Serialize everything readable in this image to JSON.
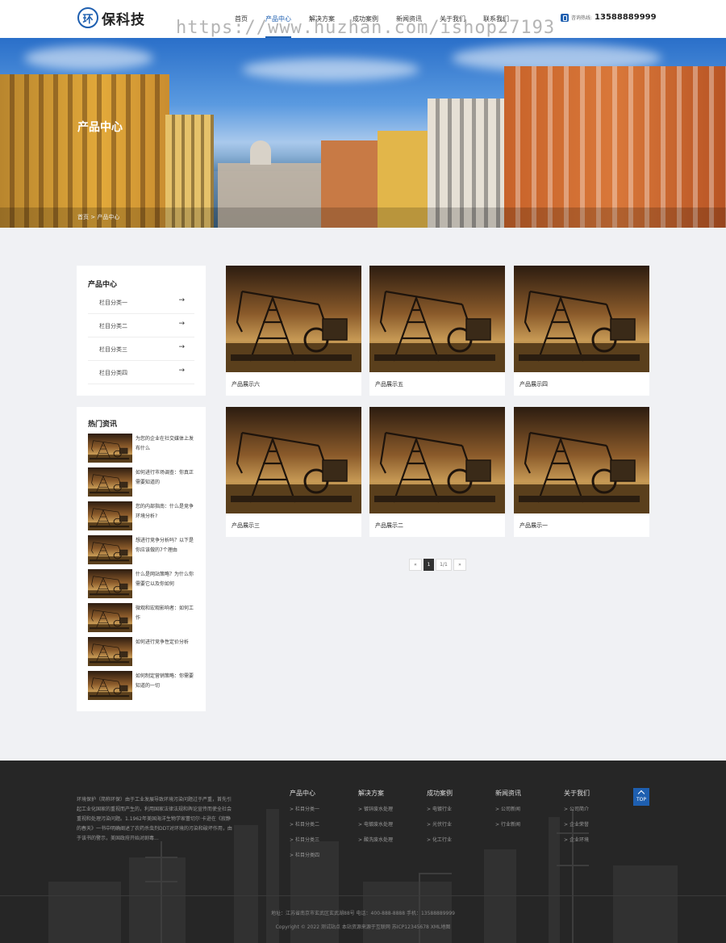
{
  "header": {
    "logo_badge": "环",
    "logo_text": "保科技",
    "nav": [
      "首页",
      "产品中心",
      "解决方案",
      "成功案例",
      "新闻资讯",
      "关于我们",
      "联系我们"
    ],
    "active_nav": "产品中心",
    "hotline_label": "咨询热线:",
    "hotline_number": "13588889999",
    "watermark": "https://www.huzhan.com/ishop27193"
  },
  "banner": {
    "title": "产品中心",
    "breadcrumb": "首页 > 产品中心"
  },
  "sidebar": {
    "categories_title": "产品中心",
    "categories": [
      "栏目分类一",
      "栏目分类二",
      "栏目分类三",
      "栏目分类四"
    ],
    "arrow": "→",
    "news_title": "热门资讯",
    "news": [
      "为您的企业在社交媒体上发布什么",
      "如何进行市场调查：你真正需要知道的",
      "您的内部指南：什么是竞争环境分析?",
      "想进行竞争分析吗？以下是你应该做的7个理由",
      "什么是网站策略？为什么你需要它以及你如何",
      "微观和宏观影响者：如何工作",
      "如何进行竞争性定价分析",
      "如何制定营销策略：你需要知道的一切"
    ]
  },
  "products": [
    "产品展示六",
    "产品展示五",
    "产品展示四",
    "产品展示三",
    "产品展示二",
    "产品展示一"
  ],
  "pagination": {
    "prev": "«",
    "current": "1",
    "total": "1/1",
    "next": "»"
  },
  "footer": {
    "about": "环境保护（简称环保）由于工业发展导致环境污染问题过于严重，首先引起工业化国家的重视而产生的，利用国家法律法规和舆论宣传而使全社会重视和处理污染问题。1.1962年美国海洋生物学家蕾切尔·卡逊在《寂静的春天》一书中明确阐述了农药杀虫剂DDT对环境的污染和破坏作用，由于该书的警示，美国政府开始对剧毒...",
    "columns": [
      {
        "title": "产品中心",
        "links": [
          "栏目分类一",
          "栏目分类二",
          "栏目分类三",
          "栏目分类四"
        ]
      },
      {
        "title": "解决方案",
        "links": [
          "镀锌废水处理",
          "电镀废水处理",
          "酸洗废水处理"
        ]
      },
      {
        "title": "成功案例",
        "links": [
          "电镀行业",
          "光伏行业",
          "化工行业"
        ]
      },
      {
        "title": "新闻资讯",
        "links": [
          "公司新闻",
          "行业新闻"
        ]
      },
      {
        "title": "关于我们",
        "links": [
          "公司简介",
          "企业荣誉",
          "企业环境"
        ]
      }
    ],
    "link_prefix": ">",
    "top_button": "TOP",
    "address_line": "地址：江苏省南京市玄武区玄武湖88号    电话：400-888-8888    手机：13588889999",
    "copyright_line": "Copyright © 2022 测试站点 本站资源来源于互联网    苏ICP12345678    XML地图"
  },
  "colors": {
    "brand": "#1e5fb0",
    "footer_bg": "#262626",
    "page_bg": "#f0f1f4"
  }
}
